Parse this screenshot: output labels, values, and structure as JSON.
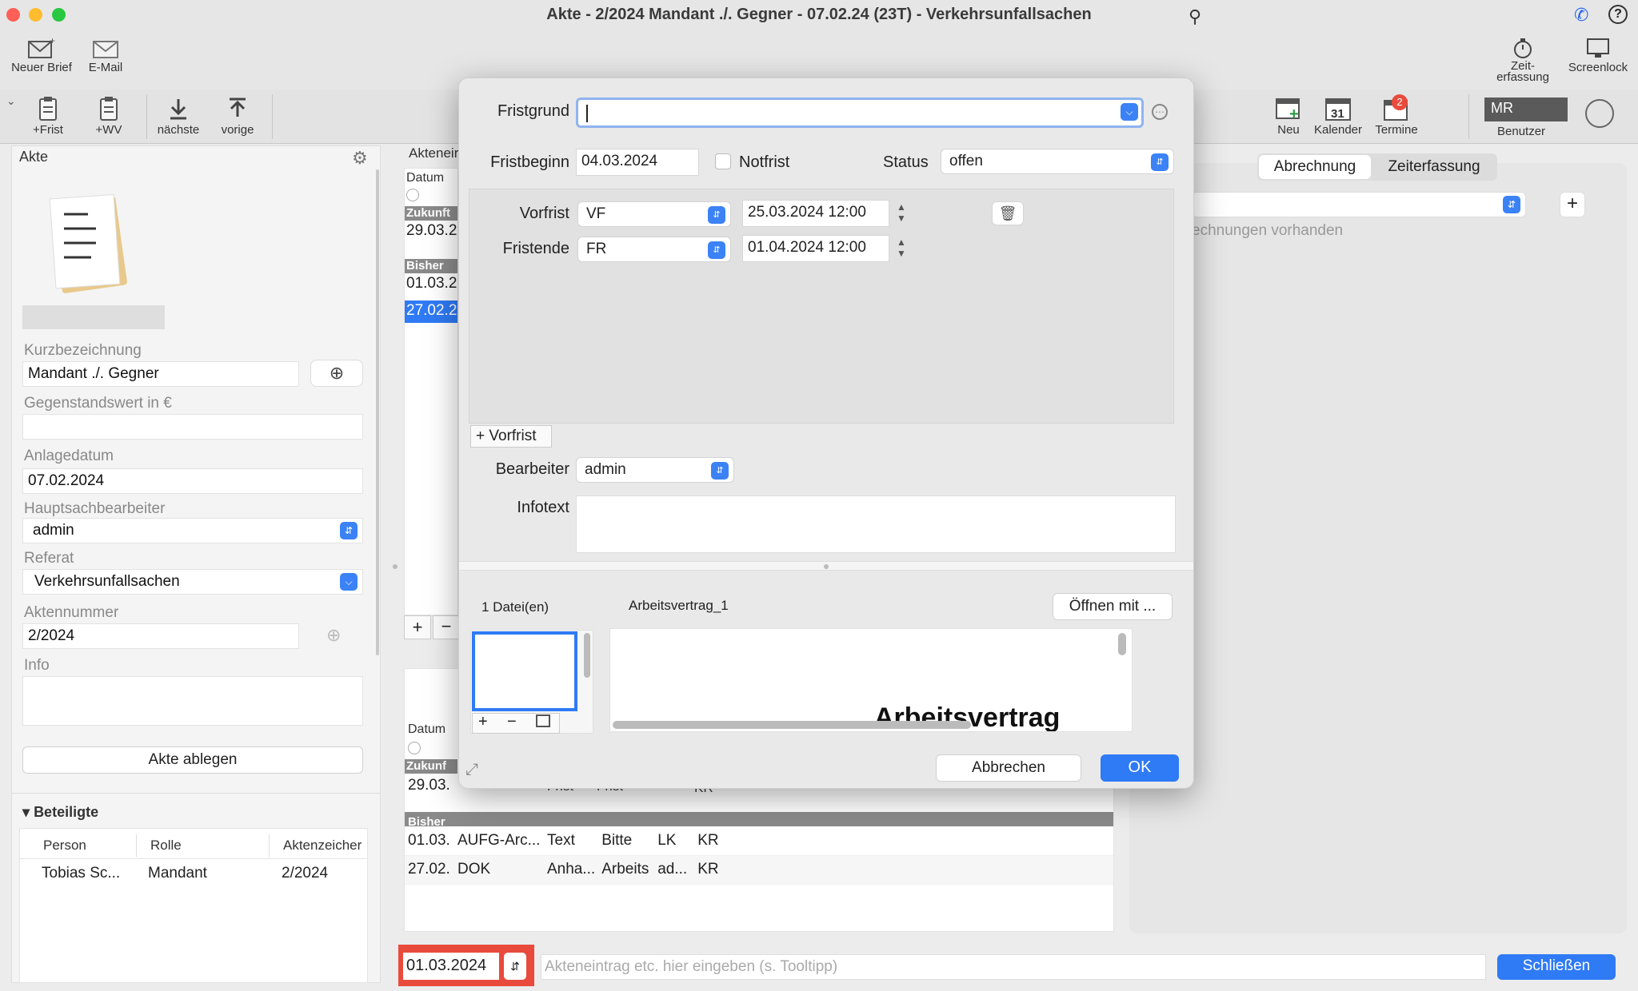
{
  "window": {
    "title": "Akte - 2/2024 Mandant ./. Gegner - 07.02.24 (23T) - Verkehrsunfallsachen"
  },
  "toolbar": {
    "new_letter": "Neuer Brief",
    "email": "E-Mail",
    "plus_frist": "+Frist",
    "plus_wv": "+WV",
    "next": "nächste",
    "prev": "vorige",
    "zeiterfassung": "Zeit-\nerfassung",
    "screenlock": "Screenlock",
    "neu": "Neu",
    "kalender": "Kalender",
    "kalender_day": "31",
    "termine": "Termine",
    "termine_badge": "2",
    "user_initials": "MR",
    "benutzer": "Benutzer"
  },
  "left": {
    "header": "Akte",
    "kurz_label": "Kurzbezeichnung",
    "kurz_value": "Mandant ./. Gegner",
    "gegen_label": "Gegenstandswert in €",
    "anlage_label": "Anlagedatum",
    "anlage_value": "07.02.2024",
    "haupt_label": "Hauptsachbearbeiter",
    "haupt_value": "admin",
    "referat_label": "Referat",
    "referat_value": "Verkehrsunfallsachen",
    "akten_label": "Aktennummer",
    "akten_value": "2/2024",
    "info_label": "Info",
    "ablegen": "Akte ablegen",
    "beteiligte": "Beteiligte",
    "cols": [
      "Person",
      "Rolle",
      "Aktenzeicher"
    ],
    "row": [
      "Tobias Sc...",
      "Mandant",
      "2/2024"
    ]
  },
  "mid": {
    "header": "Akteneir",
    "datum": "Datum",
    "zukunft": "Zukunft",
    "d1": "29.03.2",
    "bisher": "Bisher",
    "d2": "01.03.2",
    "d3": "27.02.2",
    "datum2": "Datum",
    "zukunft2": "Zukunf",
    "d4": "29.03.",
    "bisher2": "Bisher",
    "rows": [
      [
        "01.03.",
        "AUFG-Arc...",
        "Text",
        "Bitte",
        "LK",
        "KR"
      ],
      [
        "27.02.",
        "DOK",
        "Anha...",
        "Arbeits",
        "ad...",
        "KR"
      ]
    ],
    "partial": [
      "Frist",
      "Frist",
      "KR"
    ]
  },
  "right": {
    "tab1": "Abrechnung",
    "tab2": "Zeiterfassung",
    "none": "echnungen vorhanden"
  },
  "dialog": {
    "fristgrund_label": "Fristgrund",
    "fristgrund_value": "",
    "fristbeginn_label": "Fristbeginn",
    "fristbeginn_value": "04.03.2024",
    "notfrist": "Notfrist",
    "status_label": "Status",
    "status_value": "offen",
    "vorfrist_label": "Vorfrist",
    "vorfrist_type": "VF",
    "vorfrist_date": "25.03.2024 12:00",
    "fristende_label": "Fristende",
    "fristende_type": "FR",
    "fristende_date": "01.04.2024 12:00",
    "add_vorfrist": "+ Vorfrist",
    "bearbeiter_label": "Bearbeiter",
    "bearbeiter_value": "admin",
    "infotext_label": "Infotext",
    "files_count": "1 Datei(en)",
    "file_name": "Arbeitsvertrag_1",
    "open_with": "Öffnen mit ...",
    "preview_text": "Arbeitsvertrag",
    "cancel": "Abbrechen",
    "ok": "OK"
  },
  "bottom": {
    "date": "01.03.2024",
    "placeholder": "Akteneintrag etc. hier eingeben (s. Tooltipp)",
    "close": "Schließen"
  },
  "colors": {
    "accent": "#2f7af5",
    "red": "#e84b3c"
  }
}
